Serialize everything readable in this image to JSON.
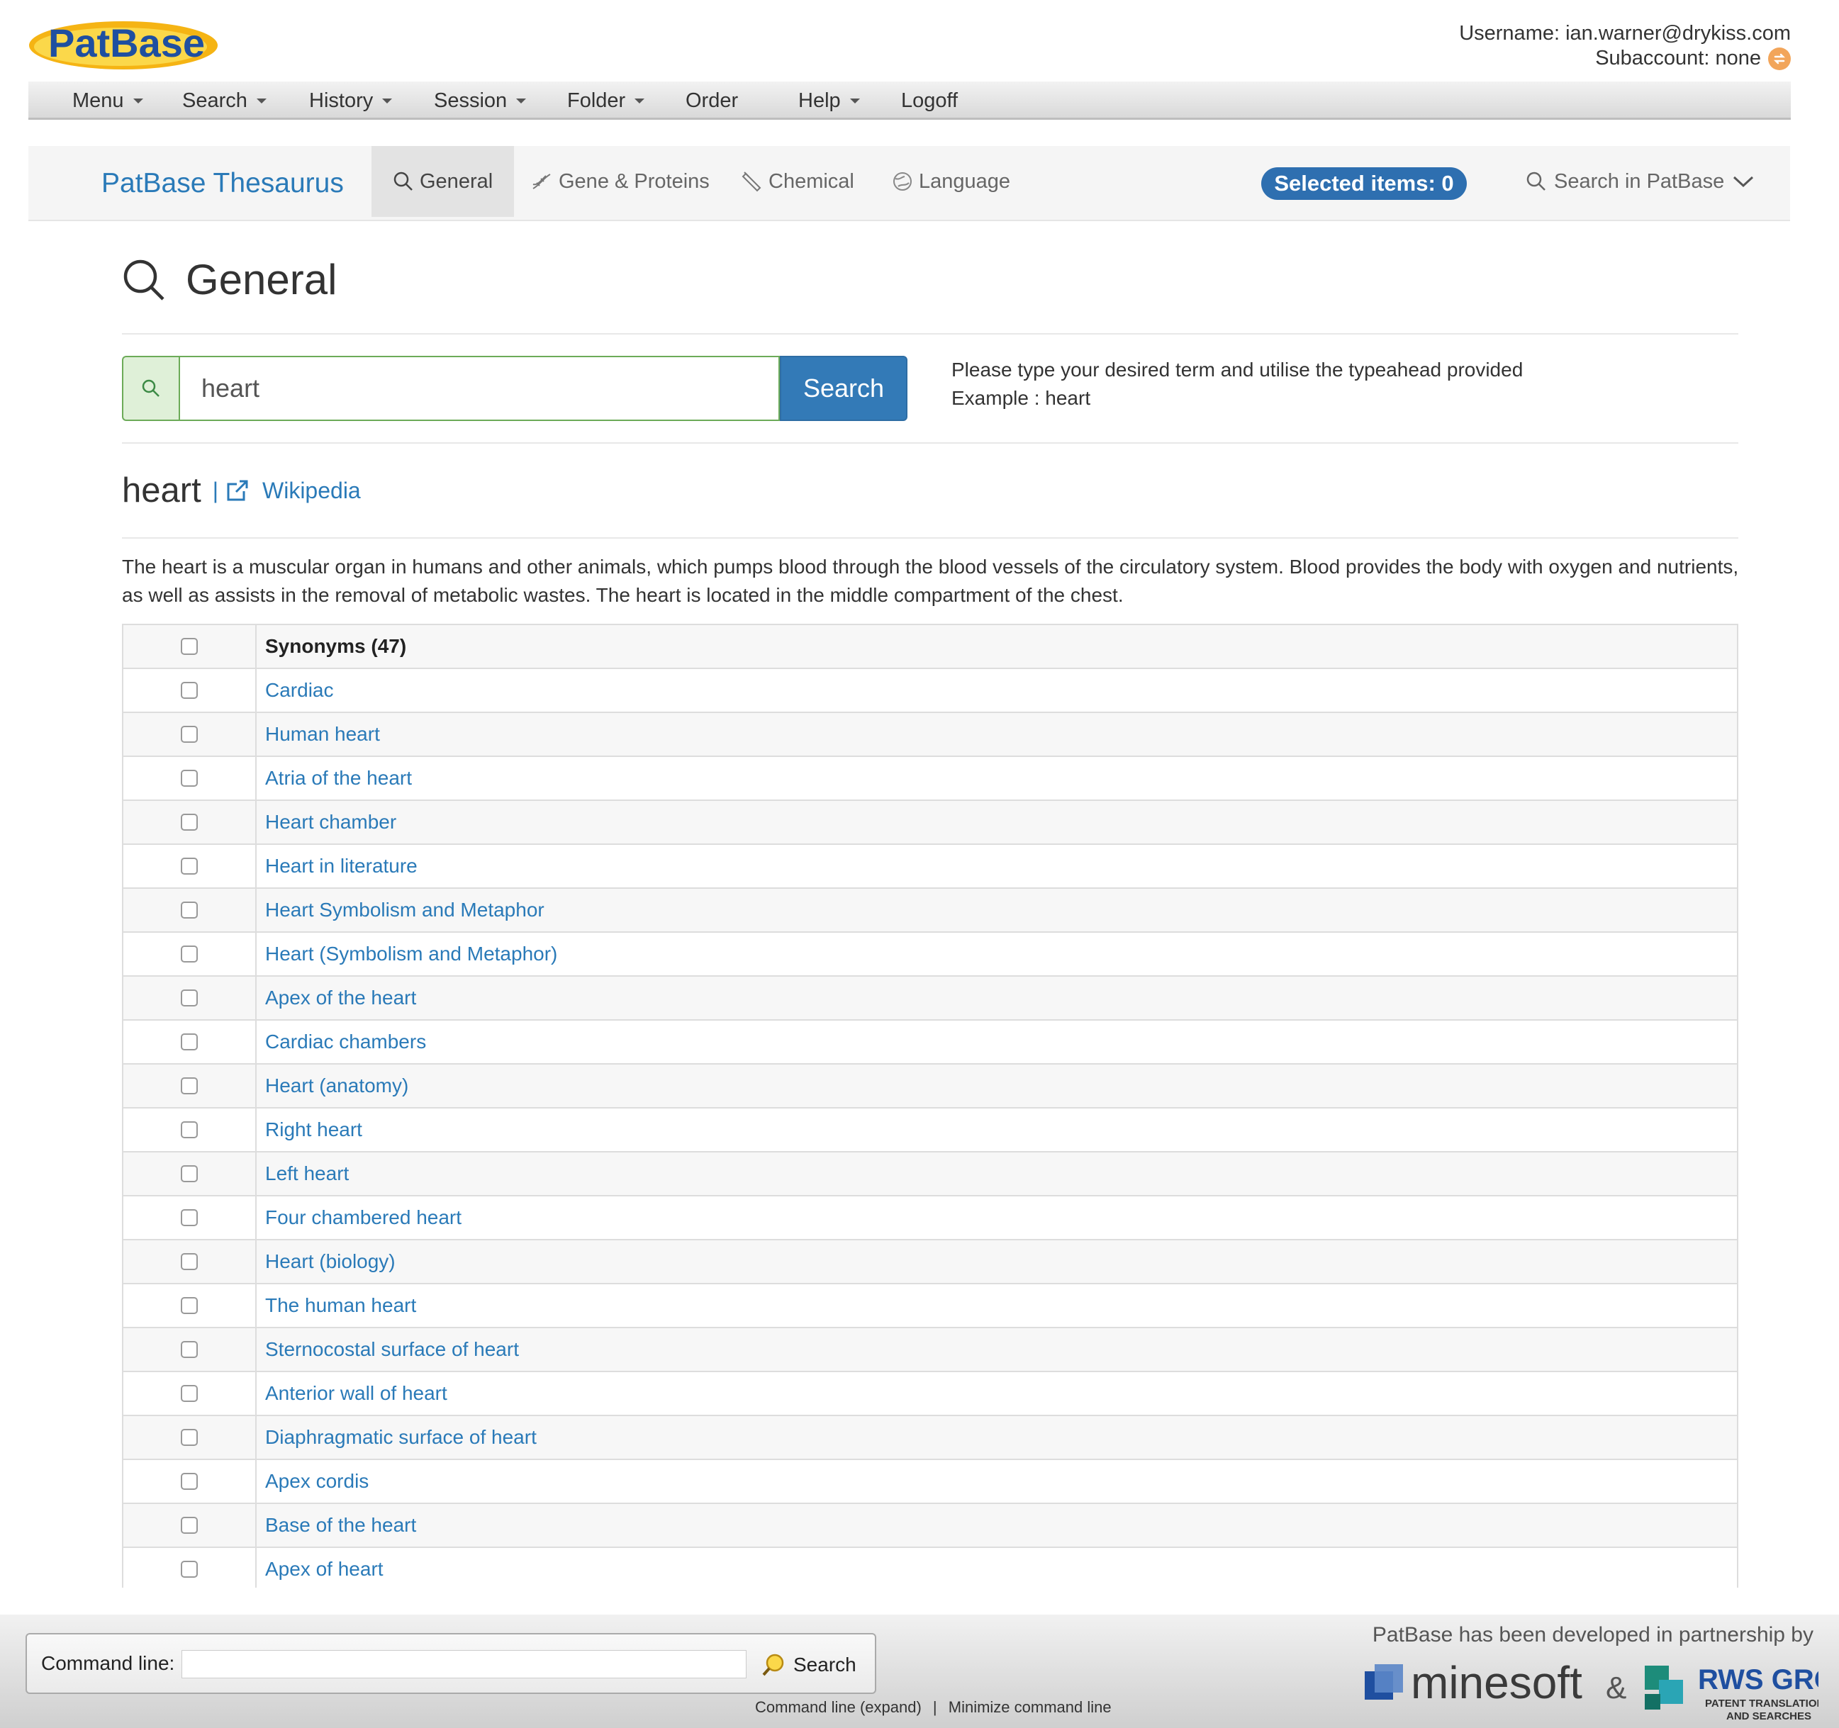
{
  "header": {
    "logo_text": "PatBase",
    "username_line": "Username: ian.warner@drykiss.com",
    "subaccount_line": "Subaccount: none"
  },
  "menubar": {
    "items": [
      {
        "label": "Menu",
        "dropdown": true
      },
      {
        "label": "Search",
        "dropdown": true
      },
      {
        "label": "History",
        "dropdown": true
      },
      {
        "label": "Session",
        "dropdown": true
      },
      {
        "label": "Folder",
        "dropdown": true
      },
      {
        "label": "Order",
        "dropdown": false
      },
      {
        "label": "Help",
        "dropdown": true
      },
      {
        "label": "Logoff",
        "dropdown": false
      }
    ]
  },
  "thesaurus_nav": {
    "brand": "PatBase Thesaurus",
    "tabs": [
      {
        "label": "General",
        "icon": "search-icon",
        "active": true
      },
      {
        "label": "Gene & Proteins",
        "icon": "dna-icon",
        "active": false
      },
      {
        "label": "Chemical",
        "icon": "test-tube-icon",
        "active": false
      },
      {
        "label": "Language",
        "icon": "globe-icon",
        "active": false
      }
    ],
    "selected_items": "Selected items: 0",
    "search_in_patbase": "Search in PatBase"
  },
  "page": {
    "title": "General",
    "search_value": "heart",
    "search_button": "Search",
    "help_line1": "Please type your desired term and utilise the typeahead provided",
    "help_line2": "Example : heart"
  },
  "term": {
    "title": "heart",
    "separator": "|",
    "wiki_label": "Wikipedia",
    "description": "The heart is a muscular organ in humans and other animals, which pumps blood through the blood vessels of the circulatory system. Blood provides the body with oxygen and nutrients, as well as assists in the removal of metabolic wastes. The heart is located in the middle compartment of the chest."
  },
  "synonyms": {
    "header": "Synonyms (47)",
    "items": [
      "Cardiac",
      "Human heart",
      "Atria of the heart",
      "Heart chamber",
      "Heart in literature",
      "Heart Symbolism and Metaphor",
      "Heart (Symbolism and Metaphor)",
      "Apex of the heart",
      "Cardiac chambers",
      "Heart (anatomy)",
      "Right heart",
      "Left heart",
      "Four chambered heart",
      "Heart (biology)",
      "The human heart",
      "Sternocostal surface of heart",
      "Anterior wall of heart",
      "Diaphragmatic surface of heart",
      "Apex cordis",
      "Base of the heart",
      "Apex of heart"
    ]
  },
  "footer": {
    "cmd_label": "Command line:",
    "cmd_value": "",
    "cmd_search": "Search",
    "link_expand": "Command line (expand)",
    "link_sep": "|",
    "link_minimize": "Minimize command line",
    "partner_text": "PatBase has been developed in partnership by",
    "minesoft": "minesoft",
    "ampersand": "&",
    "rws_title": "RWS GROUP",
    "rws_sub1": "PATENT TRANSLATIONS",
    "rws_sub2": "AND SEARCHES"
  },
  "colors": {
    "link_blue": "#2a7ab8",
    "button_blue": "#337ab7",
    "pill_blue": "#2e6fb0",
    "addon_green": "#dff0d8"
  }
}
